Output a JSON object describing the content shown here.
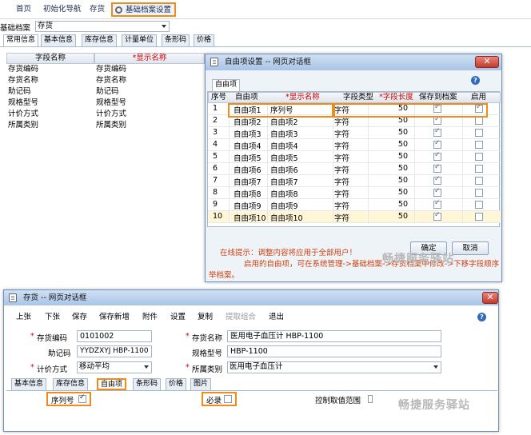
{
  "nav": {
    "tabs": [
      "首页",
      "初始化导航",
      "存货",
      "基础档案设置"
    ]
  },
  "form": {
    "label": "基础档案",
    "value": "存货"
  },
  "sub_tabs": [
    "常用信息",
    "基本信息",
    "库存信息",
    "计量单位",
    "条形码",
    "价格"
  ],
  "left_grid": {
    "headers": [
      "字段名称",
      "*显示名称"
    ],
    "rows": [
      [
        "存货编码",
        "存货编码"
      ],
      [
        "存货名称",
        "存货名称"
      ],
      [
        "助记码",
        "助记码"
      ],
      [
        "规格型号",
        "规格型号"
      ],
      [
        "计价方式",
        "计价方式"
      ],
      [
        "所属类别",
        "所属类别"
      ]
    ]
  },
  "custom_dialog": {
    "title": "自由项设置 -- 网页对话框",
    "tab": "自由项",
    "headers": [
      "序号",
      "自由项",
      "*显示名称",
      "字段类型",
      "*字段长度",
      "保存到档案",
      "启用"
    ],
    "rows": [
      {
        "no": "1",
        "item": "自由项1",
        "name": "序列号",
        "type": "字符",
        "len": "50",
        "save": true,
        "enable": true
      },
      {
        "no": "2",
        "item": "自由项2",
        "name": "自由项2",
        "type": "字符",
        "len": "50",
        "save": true,
        "enable": false
      },
      {
        "no": "3",
        "item": "自由项3",
        "name": "自由项3",
        "type": "字符",
        "len": "50",
        "save": true,
        "enable": false
      },
      {
        "no": "4",
        "item": "自由项4",
        "name": "自由项4",
        "type": "字符",
        "len": "50",
        "save": true,
        "enable": false
      },
      {
        "no": "5",
        "item": "自由项5",
        "name": "自由项5",
        "type": "字符",
        "len": "50",
        "save": true,
        "enable": false
      },
      {
        "no": "6",
        "item": "自由项6",
        "name": "自由项6",
        "type": "字符",
        "len": "50",
        "save": true,
        "enable": false
      },
      {
        "no": "7",
        "item": "自由项7",
        "name": "自由项7",
        "type": "字符",
        "len": "50",
        "save": true,
        "enable": false
      },
      {
        "no": "8",
        "item": "自由项8",
        "name": "自由项8",
        "type": "字符",
        "len": "50",
        "save": true,
        "enable": false
      },
      {
        "no": "9",
        "item": "自由项9",
        "name": "自由项9",
        "type": "字符",
        "len": "50",
        "save": true,
        "enable": false
      },
      {
        "no": "10",
        "item": "自由项10",
        "name": "自由项10",
        "type": "字符",
        "len": "50",
        "save": true,
        "enable": false
      }
    ],
    "ok": "确定",
    "cancel": "取消",
    "hint1": "在线提示：调整内容将应用于全部用户！",
    "hint2": "启用的自由项，可在系统管理->基础档案->存货档案中修改->下移字段顺序",
    "hint3": "举档案。"
  },
  "inv_dialog": {
    "title": "存货 -- 网页对话框",
    "toolbar": [
      "上张",
      "下张",
      "保存",
      "保存新增",
      "附件",
      "设置",
      "复制",
      "提取组合",
      "退出"
    ],
    "code_label": "存货编码",
    "code": "0101002",
    "name_label": "存货名称",
    "name": "医用电子血压计 HBP-1100",
    "mnemonic_label": "助记码",
    "mnemonic": "YYDZXYJ HBP-1100",
    "spec_label": "规格型号",
    "spec": "HBP-1100",
    "pricing_label": "计价方式",
    "pricing": "移动平均",
    "category_label": "所属类别",
    "category": "医用电子血压计",
    "tabs": [
      "基本信息",
      "库存信息",
      "自由项",
      "条形码",
      "价格",
      "图片"
    ],
    "serial_label": "序列号",
    "required_label": "必录",
    "range_label": "控制取值范围"
  },
  "watermark": "畅捷服务驿站"
}
